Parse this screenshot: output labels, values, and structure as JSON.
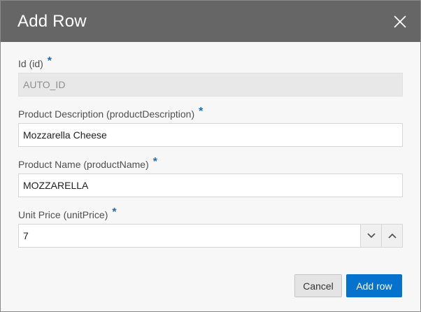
{
  "dialog": {
    "title": "Add Row"
  },
  "fields": [
    {
      "label": "Id (id)",
      "required": "*",
      "value": "AUTO_ID",
      "disabled": true
    },
    {
      "label": "Product Description (productDescription)",
      "required": "*",
      "value": "Mozzarella Cheese"
    },
    {
      "label": "Product Name (productName)",
      "required": "*",
      "value": "MOZZARELLA"
    },
    {
      "label": "Unit Price (unitPrice)",
      "required": "*",
      "value": "7"
    }
  ],
  "buttons": {
    "cancel": "Cancel",
    "submit": "Add row"
  },
  "icons": {
    "close": "close-icon",
    "decrement": "chevron-down-icon",
    "increment": "chevron-up-icon"
  },
  "colors": {
    "header": "#666666",
    "accent": "#0572ce"
  }
}
